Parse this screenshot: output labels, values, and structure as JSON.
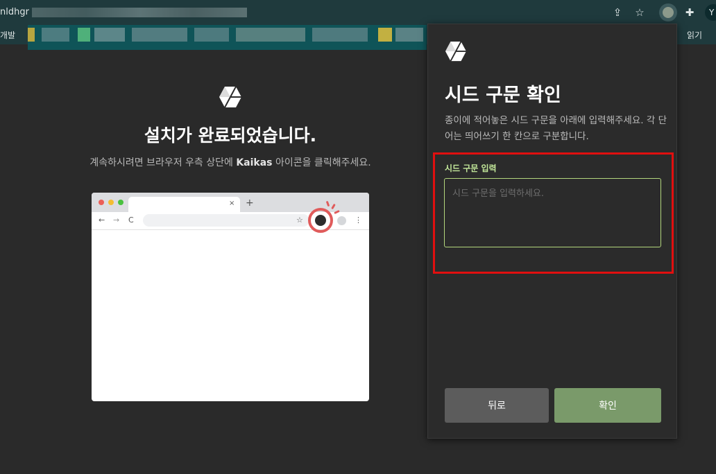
{
  "browser": {
    "url_text": "nldhgr",
    "bookmarks_label": "개발",
    "reading_list_label": "읽기",
    "profile_initial": "Y",
    "icons": [
      "share-icon",
      "star-icon",
      "kaikas-extension-icon",
      "puzzle-icon"
    ]
  },
  "main": {
    "title": "설치가 완료되었습니다.",
    "subtitle_before": "계속하시려면 브라우저 우측 상단에 ",
    "subtitle_brand": "Kaikas",
    "subtitle_after": " 아이콘을 클릭해주세요.",
    "illustration": {
      "tab_close": "×",
      "new_tab": "+",
      "nav_back": "←",
      "nav_forward": "→",
      "nav_reload": "C",
      "bookmark_star": "☆",
      "menu": "⋮"
    }
  },
  "popup": {
    "title": "시드 구문 확인",
    "description": "종이에 적어놓은 시드 구문을 아래에 입력해주세요. 각 단어는 띄어쓰기 한 칸으로 구분합니다.",
    "input_label": "시드 구문 입력",
    "input_placeholder": "시드 구문을 입력하세요.",
    "input_value": "",
    "back_label": "뒤로",
    "confirm_label": "확인"
  },
  "colors": {
    "accent_green": "#c3e89a",
    "confirm_button": "#7a9a6a",
    "highlight_red": "#e10f0f"
  }
}
